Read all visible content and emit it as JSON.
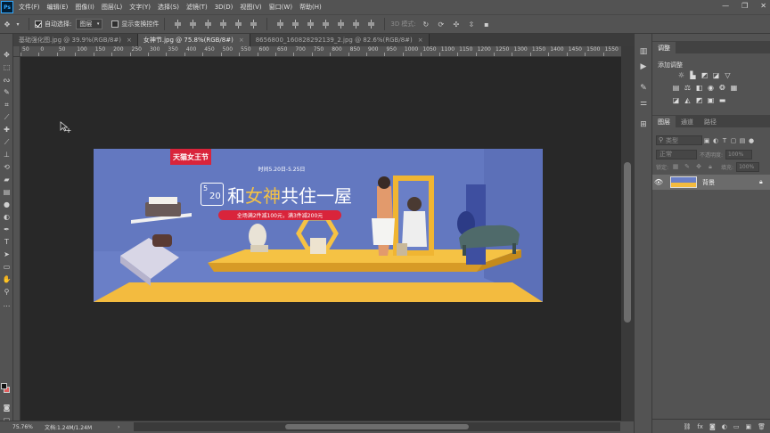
{
  "app": {
    "logo": "Ps"
  },
  "menu": [
    "文件(F)",
    "编辑(E)",
    "图像(I)",
    "图层(L)",
    "文字(Y)",
    "选择(S)",
    "滤镜(T)",
    "3D(D)",
    "视图(V)",
    "窗口(W)",
    "帮助(H)"
  ],
  "window_controls": {
    "minimize": "—",
    "maximize": "❐",
    "close": "✕"
  },
  "options": {
    "auto_select_label": "自动选择:",
    "auto_select_checked": true,
    "auto_select_target": "图层",
    "show_transform_label": "显示变换控件",
    "show_transform_checked": false,
    "mode_3d_label": "3D 模式:"
  },
  "tabs": [
    {
      "label": "基础强化图.jpg @ 39.9%(RGB/8#)",
      "active": false
    },
    {
      "label": "女神节.jpg @ 75.8%(RGB/8#)",
      "active": true
    },
    {
      "label": "8656800_160828292139_2.jpg @ 82.6%(RGB/8#)",
      "active": false
    }
  ],
  "ruler_labels": [
    "50",
    "0",
    "50",
    "100",
    "150",
    "200",
    "250",
    "300",
    "350",
    "400",
    "450",
    "500",
    "550",
    "600",
    "650",
    "700",
    "750",
    "800",
    "850",
    "900",
    "950",
    "1000",
    "1050",
    "1100",
    "1150",
    "1200",
    "1250",
    "1300",
    "1350",
    "1400",
    "1450",
    "1500",
    "1550"
  ],
  "status": {
    "zoom": "75.76%",
    "doc": "文档:1.24M/1.24M"
  },
  "banner": {
    "brand_badge": "天猫女王节",
    "date_range": "时间5.20日-5.25日",
    "date_badge_top": "5",
    "date_badge_bottom": "20",
    "headline_a": "和",
    "headline_b": "女神",
    "headline_c": "共住一屋",
    "promo": "全场满2件减100元，满3件减200元",
    "colors": {
      "bg": "#6a7fc7",
      "floor": "#f3bb3f",
      "badge": "#d9243b",
      "headline": "#ffffff",
      "accent": "#f5c244"
    }
  },
  "panels": {
    "adjust_tab": "调整",
    "add_adjust_label": "添加调整",
    "layers_tabs": [
      "图层",
      "通道",
      "路径"
    ],
    "filter_placeholder": "类型",
    "blend_mode": "正常",
    "opacity_label": "不透明度:",
    "opacity_value": "100%",
    "lock_label": "锁定:",
    "fill_label": "填充:",
    "fill_value": "100%",
    "layer_name": "背景"
  },
  "icons": {
    "eye": "eye-icon",
    "lock": "lock-icon",
    "move": "move-tool-icon",
    "search": "search-icon"
  }
}
